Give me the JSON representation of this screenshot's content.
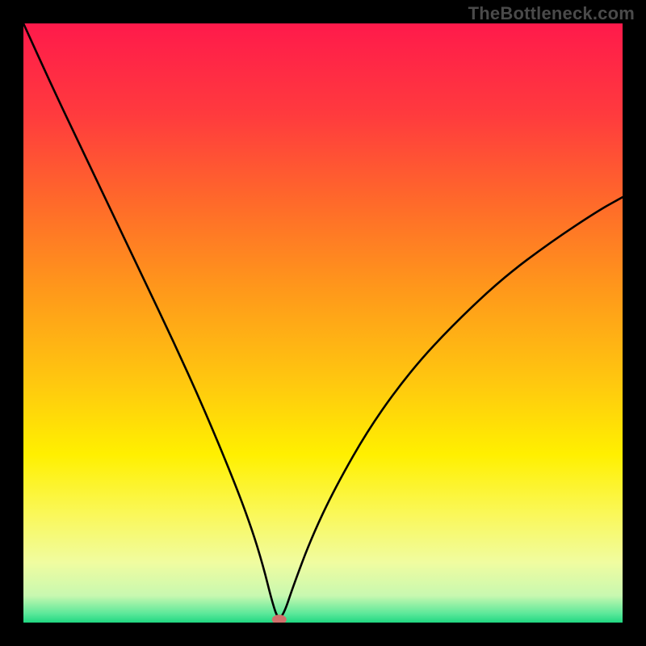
{
  "watermark": "TheBottleneck.com",
  "chart_data": {
    "type": "line",
    "title": "",
    "xlabel": "",
    "ylabel": "",
    "xlim": [
      0,
      100
    ],
    "ylim": [
      0,
      100
    ],
    "grid": false,
    "legend": false,
    "series": [
      {
        "name": "curve",
        "x": [
          0,
          5,
          10,
          15,
          20,
          25,
          30,
          35,
          38,
          40,
          41.5,
          42.5,
          43.5,
          45,
          48,
          52,
          58,
          65,
          72,
          80,
          88,
          96,
          100
        ],
        "y": [
          100,
          89,
          78.5,
          68,
          57.5,
          47,
          36,
          24,
          16,
          9.5,
          3.5,
          0.5,
          1.5,
          6,
          14,
          22.5,
          33,
          42.5,
          50,
          57.5,
          63.5,
          68.8,
          71
        ]
      }
    ],
    "background_gradient": {
      "stops": [
        {
          "pos": 0.0,
          "color": "#ff1a4b"
        },
        {
          "pos": 0.15,
          "color": "#ff3a3e"
        },
        {
          "pos": 0.3,
          "color": "#ff6a2a"
        },
        {
          "pos": 0.45,
          "color": "#ff9a1a"
        },
        {
          "pos": 0.6,
          "color": "#ffc80f"
        },
        {
          "pos": 0.72,
          "color": "#fff000"
        },
        {
          "pos": 0.82,
          "color": "#faf85a"
        },
        {
          "pos": 0.9,
          "color": "#f0fca0"
        },
        {
          "pos": 0.955,
          "color": "#c8f8b0"
        },
        {
          "pos": 0.985,
          "color": "#5ce89a"
        },
        {
          "pos": 1.0,
          "color": "#20d781"
        }
      ]
    },
    "marker": {
      "x": 42.7,
      "y": 0.5,
      "rx": 9,
      "ry": 6,
      "color": "#d1706b"
    },
    "curve_style": {
      "stroke": "#000000",
      "width": 2.6
    }
  }
}
